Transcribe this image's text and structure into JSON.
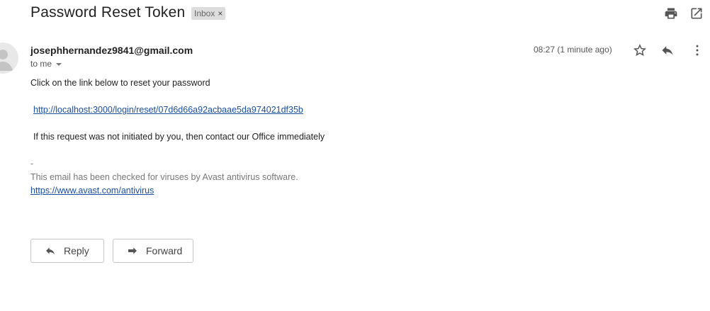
{
  "email": {
    "subject": "Password Reset Token",
    "label": "Inbox",
    "label_remove": "×",
    "sender": "josephhernandez9841@gmail.com",
    "recipient": "to me",
    "time": "08:27 (1 minute ago)"
  },
  "body": {
    "intro": "Click on the link below to reset your password",
    "reset_link": "http://localhost:3000/login/reset/07d6d66a92acbaae5da974021df35b",
    "notice": "If this request was not initiated by you, then contact our Office immediately",
    "signature_dash": "--",
    "signature_text": "This email has been checked for viruses by Avast antivirus software.",
    "signature_link": "https://www.avast.com/antivirus"
  },
  "actions": {
    "reply_label": "Reply",
    "forward_label": "Forward"
  },
  "icons": {
    "print": "print-icon",
    "open_new_window": "open-in-new-window-icon",
    "star": "star-icon",
    "reply": "reply-icon",
    "more": "more-vertical-icon",
    "avatar": "person-avatar-icon",
    "forward": "forward-icon"
  },
  "colors": {
    "link": "#1a4fa0",
    "label_chip_bg": "#dddddd",
    "muted_text": "#777777"
  }
}
